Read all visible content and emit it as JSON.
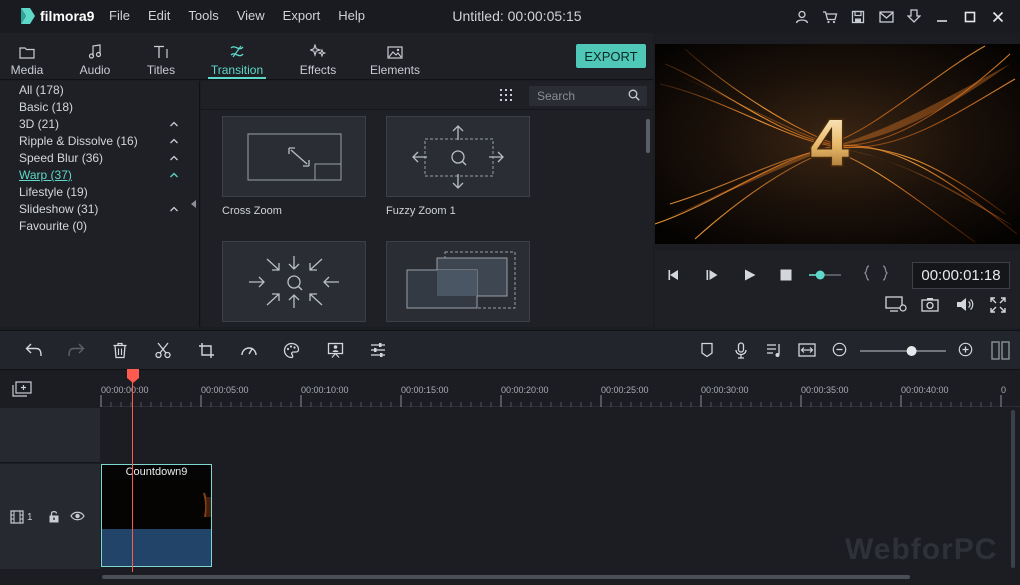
{
  "app": {
    "logo_text": "filmora9",
    "window_title": "Untitled:  00:00:05:15"
  },
  "menu": [
    "File",
    "Edit",
    "Tools",
    "View",
    "Export",
    "Help"
  ],
  "title_icons": [
    "user-icon",
    "cart-icon",
    "save-icon",
    "mail-icon",
    "download-icon",
    "minimize-icon",
    "maximize-icon",
    "close-icon"
  ],
  "tabs": [
    {
      "label": "Media",
      "icon": "folder-icon",
      "active": false
    },
    {
      "label": "Audio",
      "icon": "music-note-icon",
      "active": false
    },
    {
      "label": "Titles",
      "icon": "text-icon",
      "active": false
    },
    {
      "label": "Transition",
      "icon": "transition-icon",
      "active": true
    },
    {
      "label": "Effects",
      "icon": "sparkle-icon",
      "active": false
    },
    {
      "label": "Elements",
      "icon": "image-icon",
      "active": false
    }
  ],
  "export_label": "EXPORT",
  "categories": [
    {
      "label": "All (178)",
      "chevron": false,
      "active": false
    },
    {
      "label": "Basic (18)",
      "chevron": false,
      "active": false
    },
    {
      "label": "3D (21)",
      "chevron": true,
      "active": false
    },
    {
      "label": "Ripple & Dissolve (16)",
      "chevron": true,
      "active": false
    },
    {
      "label": "Speed Blur (36)",
      "chevron": true,
      "active": false
    },
    {
      "label": "Warp (37)",
      "chevron": true,
      "active": true
    },
    {
      "label": "Lifestyle (19)",
      "chevron": false,
      "active": false
    },
    {
      "label": "Slideshow (31)",
      "chevron": true,
      "active": false
    },
    {
      "label": "Favourite (0)",
      "chevron": false,
      "active": false
    }
  ],
  "search": {
    "placeholder": "Search"
  },
  "transitions": [
    {
      "label": "Cross Zoom"
    },
    {
      "label": "Fuzzy Zoom 1"
    },
    {
      "label": ""
    },
    {
      "label": ""
    }
  ],
  "preview": {
    "overlay_text": "4",
    "timecode": "00:00:01:18",
    "volume_level": 0.35
  },
  "timeline": {
    "ticks": [
      "00:00:00:00",
      "00:00:05:00",
      "00:00:10:00",
      "00:00:15:00",
      "00:00:20:00",
      "00:00:25:00",
      "00:00:30:00",
      "00:00:35:00",
      "00:00:40:00",
      "0"
    ],
    "zoom_level": 0.6,
    "track_number": "1",
    "clip_title": "Countdown9"
  },
  "watermark": "WebforPC",
  "colors": {
    "accent": "#5ed8c9",
    "playhead": "#ff5a4f",
    "audio_clip": "#234469"
  }
}
